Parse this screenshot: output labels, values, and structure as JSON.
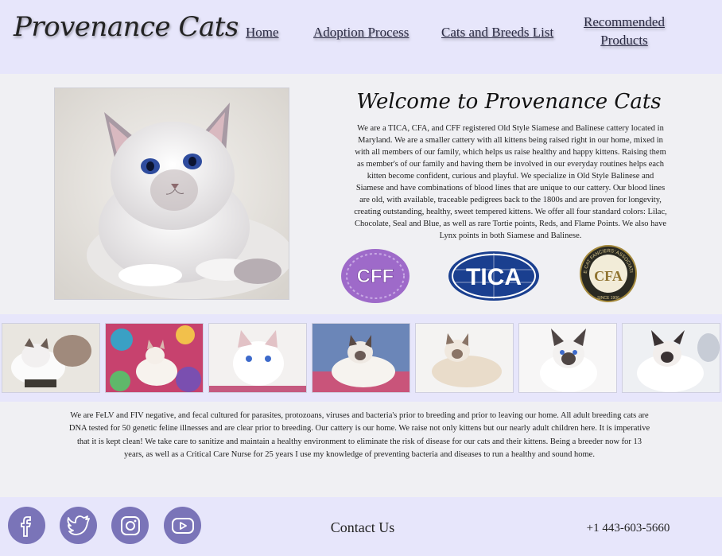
{
  "header": {
    "logo": "Provenance Cats",
    "nav": {
      "home": "Home",
      "adoption": "Adoption Process",
      "cats": "Cats and Breeds List",
      "recommended": "Recommended Products"
    }
  },
  "hero": {
    "heading": "Welcome to Provenance Cats",
    "intro": "We are a TICA, CFA, and CFF registered Old Style Siamese and Balinese cattery located in Maryland. We are a smaller cattery with all kittens being raised right in our home, mixed in with all members of our family, which helps us raise healthy and happy kittens. Raising them as member's of our family and having them be involved in our everyday routines helps each kitten become confident, curious and playful. We specialize in Old Style Balinese and Siamese and have combinations of blood lines that are unique to our cattery. Our blood lines are old, with available, traceable pedigrees back to the 1800s and are proven for longevity, creating outstanding, healthy, sweet tempered kittens. We offer all four standard colors: Lilac, Chocolate, Seal and Blue, as well as rare Tortie points, Reds, and Flame Points. We also have Lynx points in both Siamese and Balinese.",
    "badges": {
      "cff": "CFF",
      "tica": "TICA",
      "cfa_ring": "THE CAT FANCIERS' ASSOCIATION",
      "cfa_initials": "CFA",
      "cfa_year": "SINCE 1906"
    }
  },
  "health_text": "We are FeLV and FIV negative, and fecal cultured for parasites, protozoans, viruses and bacteria's prior to breeding and prior to leaving our home. All adult breeding cats are DNA tested for 50 genetic feline illnesses and are clear prior to breeding. Our cattery is our home. We raise not only kittens but our nearly adult children here. It is imperative that it is kept clean! We take care to sanitize and maintain a healthy environment to eliminate the risk of disease for our cats and their kittens. Being a breeder now for 13 years, as well as a Critical Care Nurse for 25 years I use my knowledge of preventing bacteria and diseases to run a healthy and sound home.",
  "footer": {
    "social": [
      "facebook-icon",
      "twitter-icon",
      "instagram-icon",
      "youtube-icon"
    ],
    "contact": "Contact Us",
    "phone": "+1 443-603-5660"
  },
  "colors": {
    "header_bg": "#e7e6fb",
    "page_bg": "#f0f0f3",
    "social_icon": "#7a74b8",
    "tica_blue": "#1a3f8f",
    "cff_purple": "#9e6ac9",
    "cfa_gold": "#a58a3c"
  }
}
